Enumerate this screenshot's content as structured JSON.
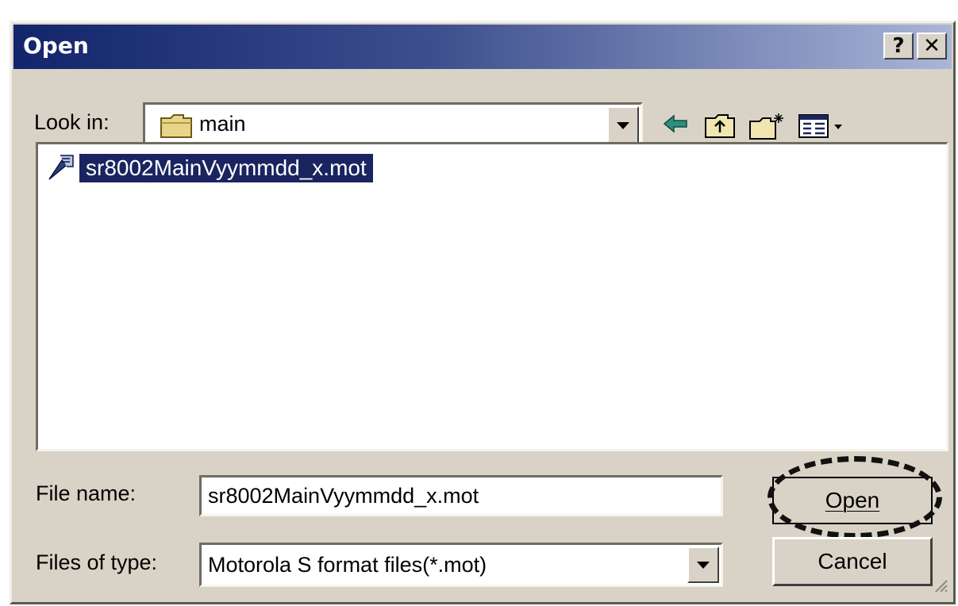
{
  "window": {
    "title": "Open",
    "help_label": "?",
    "close_label": "✕"
  },
  "look_in": {
    "label": "Look in:",
    "value": "main",
    "icon": "folder-icon"
  },
  "toolbar": {
    "back_icon": "back-arrow-icon",
    "up_icon": "up-one-level-icon",
    "new_folder_icon": "new-folder-icon",
    "view_icon": "view-menu-icon"
  },
  "file_list": {
    "items": [
      {
        "name": "sr8002MainVyymmdd_x.mot",
        "icon": "mot-file-icon",
        "selected": true
      }
    ]
  },
  "file_name": {
    "label": "File name:",
    "value": "sr8002MainVyymmdd_x.mot"
  },
  "file_type": {
    "label": "Files of type:",
    "value": "Motorola S format files(*.mot)"
  },
  "buttons": {
    "open_label": "Open",
    "cancel_label": "Cancel"
  },
  "colors": {
    "selection": "#1a2560",
    "title_start": "#13256b",
    "title_end": "#a9b6d8",
    "dialog_bg": "#d8d3c6"
  }
}
